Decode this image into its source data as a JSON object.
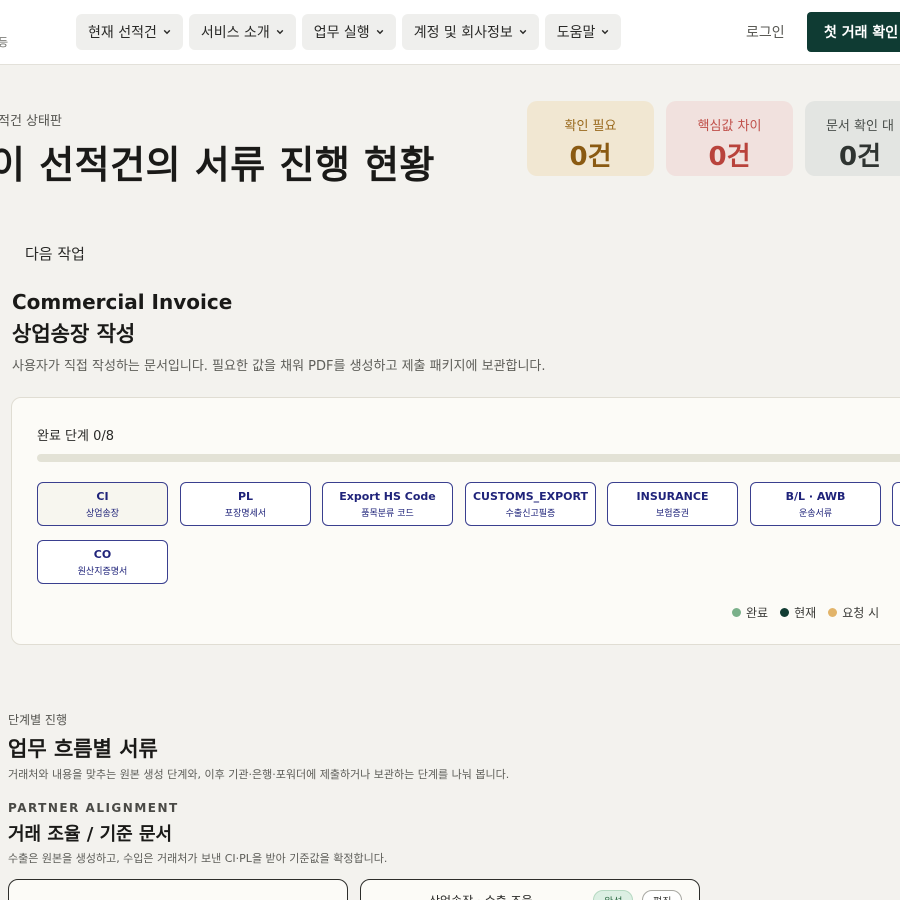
{
  "header": {
    "logo_fragment": "등",
    "nav": [
      {
        "label": "현재 선적건"
      },
      {
        "label": "서비스 소개"
      },
      {
        "label": "업무 실행"
      },
      {
        "label": "계정 및 회사정보"
      },
      {
        "label": "도움말"
      }
    ],
    "login": "로그인",
    "cta": "첫 거래 확인"
  },
  "dashboard": {
    "eyebrow": "적건 상태판",
    "title": "이 선적건의 서류 진행 현황",
    "stats": [
      {
        "label": "확인 필요",
        "value": "0건"
      },
      {
        "label": "핵심값 차이",
        "value": "0건"
      },
      {
        "label": "문서 확인 대",
        "value": "0건"
      }
    ]
  },
  "next_task": {
    "label": "다음 작업",
    "title_en": "Commercial Invoice",
    "title_ko": "상업송장 작성",
    "description": "사용자가 직접 작성하는 문서입니다. 필요한 값을 채워 PDF를 생성하고 제출 패키지에 보관합니다."
  },
  "progress": {
    "label": "완료 단계 0/8",
    "fraction": 0,
    "steps": [
      {
        "code": "CI",
        "ko": "상업송장"
      },
      {
        "code": "PL",
        "ko": "포장명세서"
      },
      {
        "code": "Export HS Code",
        "ko": "품목분류 코드"
      },
      {
        "code": "CUSTOMS_EXPORT",
        "ko": "수출신고필증"
      },
      {
        "code": "INSURANCE",
        "ko": "보험증권"
      },
      {
        "code": "B/L · AWB",
        "ko": "운송서류"
      },
      {
        "code": "CO",
        "ko": "원산지증명서"
      }
    ],
    "legend": [
      {
        "label": "완료",
        "color": "#7ab08a"
      },
      {
        "label": "현재",
        "color": "#123c33"
      },
      {
        "label": "요청 시",
        "color": "#e2b46a"
      }
    ]
  },
  "stages": {
    "eyebrow": "단계별 진행",
    "title": "업무 흐름별 서류",
    "description": "거래처와 내용을 맞추는 원본 생성 단계와, 이후 기관·은행·포워더에 제출하거나 보관하는 단계를 나눠 봅니다.",
    "group": {
      "eyebrow": "PARTNER ALIGNMENT",
      "title": "거래 조율 / 기준 문서",
      "description": "수출은 원본을 생성하고, 수입은 거래처가 보낸 CI·PL을 받아 기준값을 확정합니다."
    },
    "cards": [
      {
        "title": "",
        "pills": [
          "완성",
          "편집"
        ]
      },
      {
        "title": "상업송장 · 수출 조율"
      }
    ]
  }
}
